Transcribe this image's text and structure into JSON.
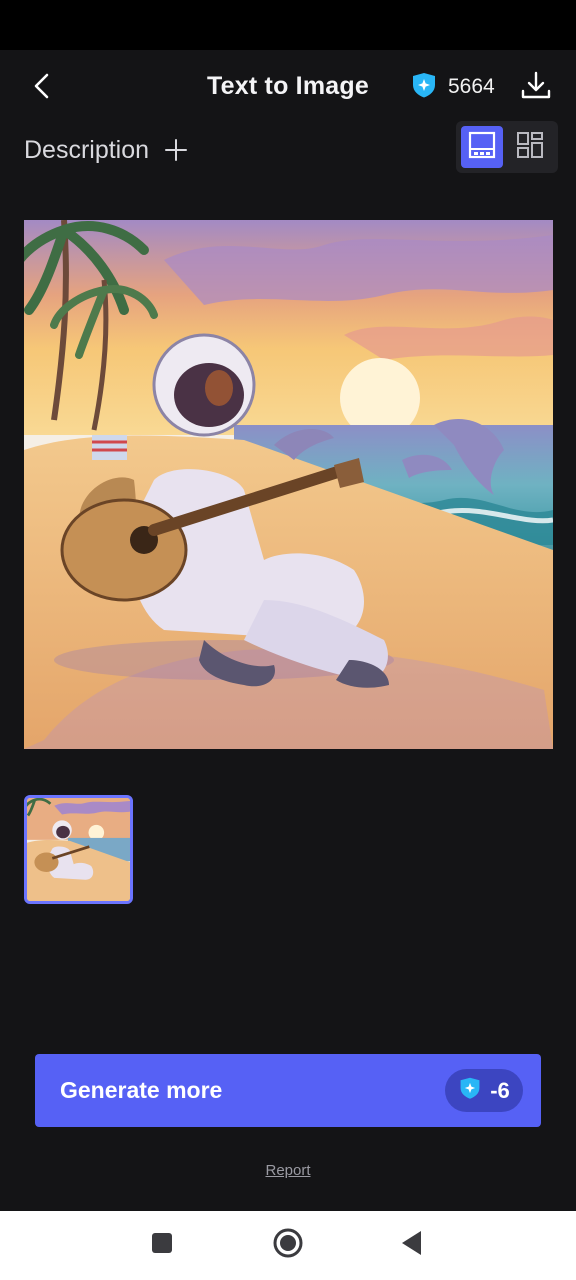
{
  "header": {
    "title": "Text to Image",
    "credits": "5664"
  },
  "description": {
    "label": "Description"
  },
  "generate": {
    "label": "Generate more",
    "cost": "-6"
  },
  "footer": {
    "report_label": "Report"
  },
  "colors": {
    "accent": "#5661f5",
    "background": "#141416",
    "credit_icon": "#29b6f6"
  },
  "icons": {
    "back": "chevron-left-icon",
    "credit": "credit-shield-icon",
    "download": "download-icon",
    "add": "plus-icon",
    "single_view": "single-view-icon",
    "grid_view": "grid-view-icon",
    "nav_recent": "square-icon",
    "nav_home": "circle-icon",
    "nav_back": "triangle-back-icon"
  }
}
